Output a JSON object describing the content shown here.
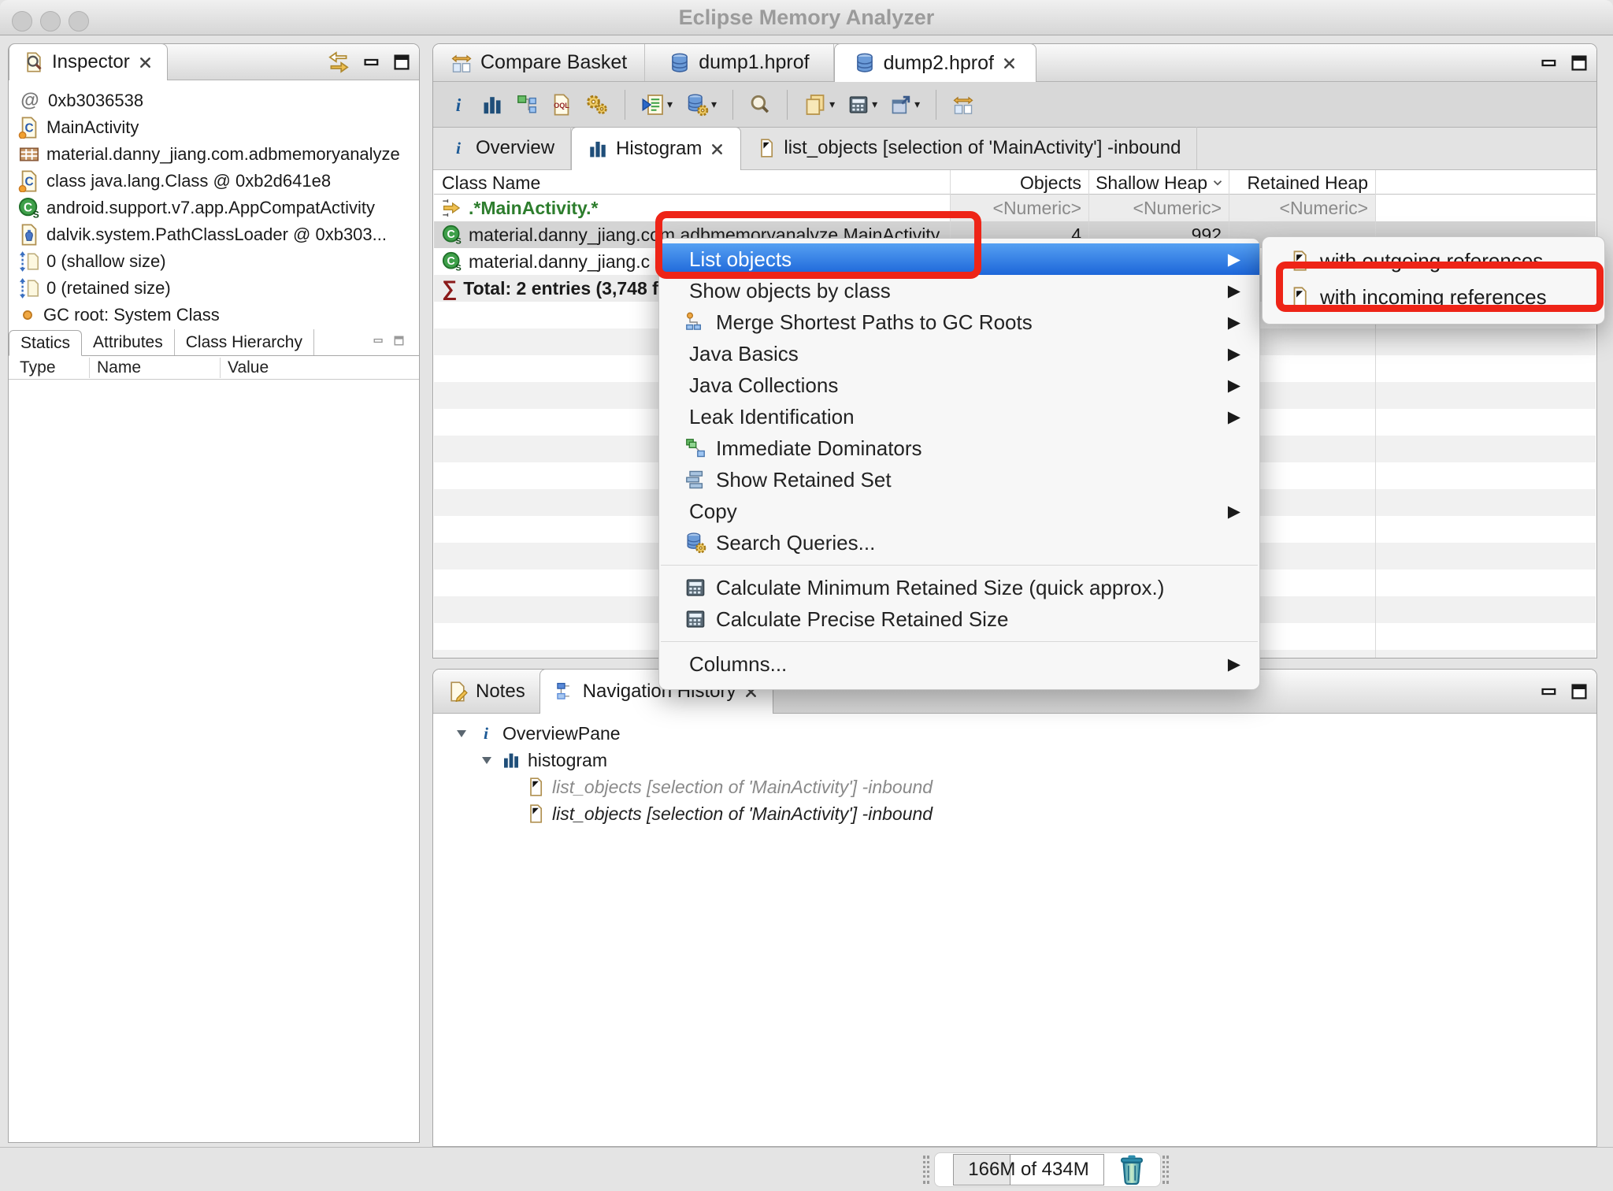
{
  "window": {
    "title": "Eclipse Memory Analyzer"
  },
  "colors": {
    "selection_blue": "#1d66d9",
    "annotation_red": "#ee2417",
    "pattern_green": "#2d7d2d"
  },
  "inspector": {
    "tab_label": "Inspector",
    "items": [
      {
        "icon": "at-icon",
        "label": "0xb3036538"
      },
      {
        "icon": "class-icon",
        "label": "MainActivity"
      },
      {
        "icon": "package-icon",
        "label": "material.danny_jiang.com.adbmemoryanalyze"
      },
      {
        "icon": "class-icon",
        "label": "class java.lang.Class @ 0xb2d641e8"
      },
      {
        "icon": "java-class-icon",
        "label": "android.support.v7.app.AppCompatActivity"
      },
      {
        "icon": "classloader-icon",
        "label": "dalvik.system.PathClassLoader @ 0xb303..."
      },
      {
        "icon": "size-icon",
        "label": "0 (shallow size)"
      },
      {
        "icon": "size-icon",
        "label": "0 (retained size)"
      },
      {
        "icon": "gc-root-icon",
        "label": "GC root: System Class"
      }
    ],
    "subtabs": [
      "Statics",
      "Attributes",
      "Class Hierarchy"
    ],
    "columns": [
      "Type",
      "Name",
      "Value"
    ]
  },
  "editor": {
    "tabs": [
      {
        "label": "Compare Basket",
        "icon": "compare-icon"
      },
      {
        "label": "dump1.hprof",
        "icon": "heap-dump-icon"
      },
      {
        "label": "dump2.hprof",
        "icon": "heap-dump-icon",
        "active": true
      }
    ],
    "inner_tabs": [
      {
        "label": "Overview",
        "icon": "info-icon"
      },
      {
        "label": "Histogram",
        "icon": "histogram-icon",
        "active": true
      },
      {
        "label": "list_objects [selection of 'MainActivity'] -inbound",
        "icon": "query-result-icon"
      }
    ],
    "table": {
      "columns": [
        "Class Name",
        "Objects",
        "Shallow Heap",
        "Retained Heap"
      ],
      "filter_row": {
        "pattern": ".*MainActivity.*",
        "objects": "<Numeric>",
        "shallow_heap": "<Numeric>",
        "retained_heap": "<Numeric>"
      },
      "rows": [
        {
          "class_name": "material.danny_jiang.com.adbmemoryanalyze.MainActivity",
          "objects": "4",
          "shallow_heap": "992",
          "retained_heap": ""
        },
        {
          "class_name": "material.danny_jiang.c",
          "objects": "",
          "shallow_heap": "",
          "retained_heap": ""
        }
      ],
      "total_row": {
        "label": "Total: 2 entries (3,748 f"
      }
    }
  },
  "context_menu": {
    "items": [
      {
        "label": "List objects",
        "selected": true,
        "has_submenu": true
      },
      {
        "label": "Show objects by class",
        "has_submenu": true
      },
      {
        "label": "Merge Shortest Paths to GC Roots",
        "icon": "merge-paths-icon",
        "has_submenu": true
      },
      {
        "label": "Java Basics",
        "has_submenu": true
      },
      {
        "label": "Java Collections",
        "has_submenu": true
      },
      {
        "label": "Leak Identification",
        "has_submenu": true
      },
      {
        "label": "Immediate Dominators",
        "icon": "immediate-dominators-icon"
      },
      {
        "label": "Show Retained Set",
        "icon": "retained-set-icon"
      },
      {
        "label": "Copy",
        "has_submenu": true
      },
      {
        "label": "Search Queries...",
        "icon": "search-queries-icon"
      },
      {
        "label": "Calculate Minimum Retained Size (quick approx.)",
        "icon": "calculator-icon"
      },
      {
        "label": "Calculate Precise Retained Size",
        "icon": "calculator-icon"
      },
      {
        "label": "Columns...",
        "has_submenu": true
      }
    ]
  },
  "submenu": {
    "items": [
      {
        "label": "with outgoing references",
        "icon": "query-result-icon"
      },
      {
        "label": "with incoming references",
        "icon": "query-result-icon"
      }
    ]
  },
  "bottom_panel": {
    "tabs": [
      {
        "label": "Notes",
        "icon": "notes-icon"
      },
      {
        "label": "Navigation History",
        "icon": "navigation-history-icon",
        "active": true
      }
    ],
    "tree": [
      {
        "label": "OverviewPane",
        "icon": "info-icon"
      },
      {
        "label": "histogram",
        "icon": "histogram-icon"
      },
      {
        "label": "list_objects [selection of 'MainActivity'] -inbound",
        "icon": "query-result-icon",
        "state": "visited"
      },
      {
        "label": "list_objects [selection of 'MainActivity'] -inbound",
        "icon": "query-result-icon",
        "state": "current"
      }
    ]
  },
  "status_bar": {
    "heap_usage": "166M of 434M"
  }
}
